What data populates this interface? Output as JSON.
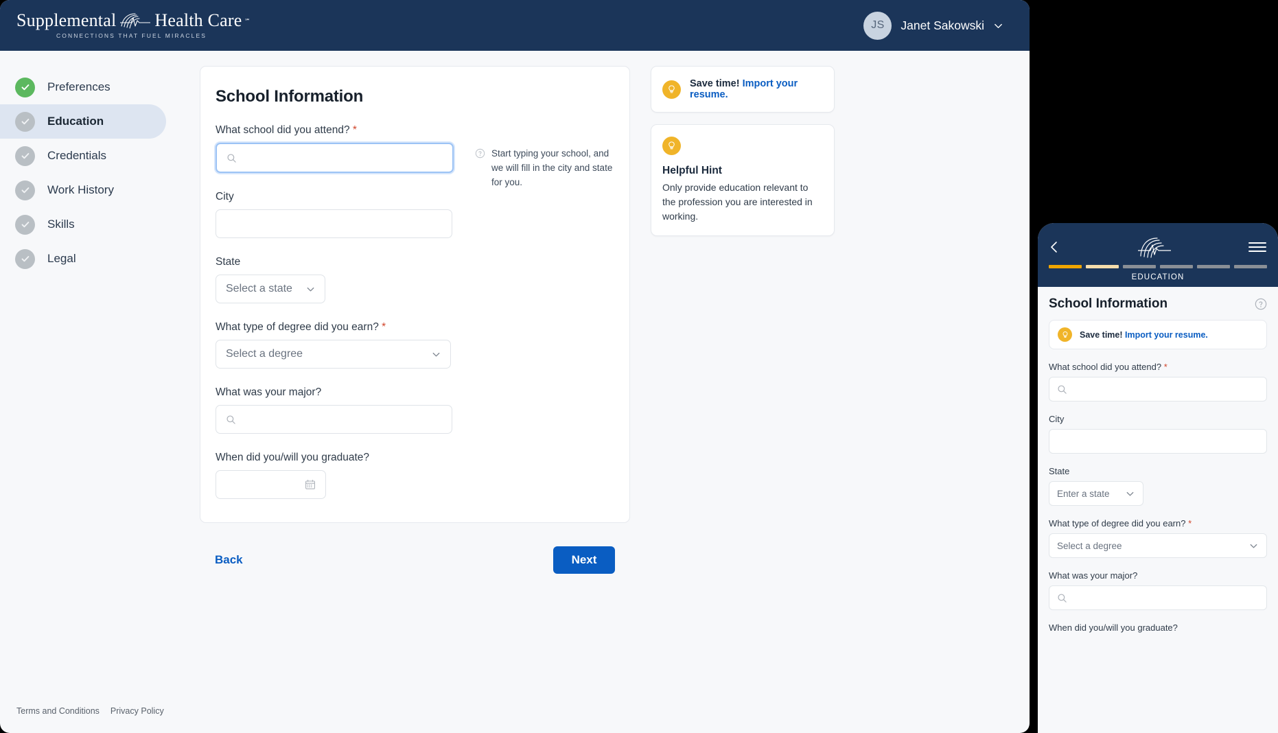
{
  "brand": {
    "name_part1": "Supplemental",
    "name_part2": "Health Care",
    "tm": "℠",
    "tagline": "CONNECTIONS THAT FUEL MIRACLES"
  },
  "header": {
    "avatar_initials": "JS",
    "user_name": "Janet Sakowski"
  },
  "sidebar": {
    "items": [
      {
        "label": "Preferences",
        "state": "complete"
      },
      {
        "label": "Education",
        "state": "current"
      },
      {
        "label": "Credentials",
        "state": "pending"
      },
      {
        "label": "Work History",
        "state": "pending"
      },
      {
        "label": "Skills",
        "state": "pending"
      },
      {
        "label": "Legal",
        "state": "pending"
      }
    ]
  },
  "form": {
    "title": "School Information",
    "school": {
      "label": "What school did you attend?",
      "required": "*",
      "value": "",
      "placeholder": "",
      "hint": "Start typing your school, and we will fill in the city and state for you."
    },
    "city": {
      "label": "City",
      "value": "",
      "placeholder": ""
    },
    "state": {
      "label": "State",
      "value": "Select a state"
    },
    "degree": {
      "label": "What type of degree did you earn?",
      "required": "*",
      "value": "Select a degree"
    },
    "major": {
      "label": "What was your major?",
      "value": "",
      "placeholder": ""
    },
    "graduation": {
      "label": "When did you/will you graduate?",
      "value": ""
    }
  },
  "actions": {
    "back": "Back",
    "next": "Next"
  },
  "rail": {
    "resume_tip_strong": "Save time!",
    "resume_tip_link": "Import your resume.",
    "hint_title": "Helpful Hint",
    "hint_body": "Only provide education relevant to the profession you are interested in working."
  },
  "footer": {
    "terms": "Terms and Conditions",
    "privacy": "Privacy Policy"
  },
  "mobile": {
    "step_label": "EDUCATION",
    "progress_segments": 6,
    "progress_filled": 1,
    "progress_partial": 1,
    "title": "School Information",
    "resume_tip_strong": "Save time!",
    "resume_tip_link": "Import your resume.",
    "school": {
      "label": "What school did you attend?",
      "required": "*",
      "value": ""
    },
    "city": {
      "label": "City",
      "value": ""
    },
    "state": {
      "label": "State",
      "value": "Enter a state"
    },
    "degree": {
      "label": "What type of degree did you earn?",
      "required": "*",
      "value": "Select a degree"
    },
    "major": {
      "label": "What was your major?",
      "value": ""
    },
    "graduation": {
      "label": "When did you/will you graduate?"
    }
  },
  "colors": {
    "navy": "#1b3559",
    "blue": "#0a5dc2",
    "green": "#5cb85f",
    "yellow": "#f0b429",
    "orange": "#f0a500",
    "required_red": "#d0452b"
  }
}
